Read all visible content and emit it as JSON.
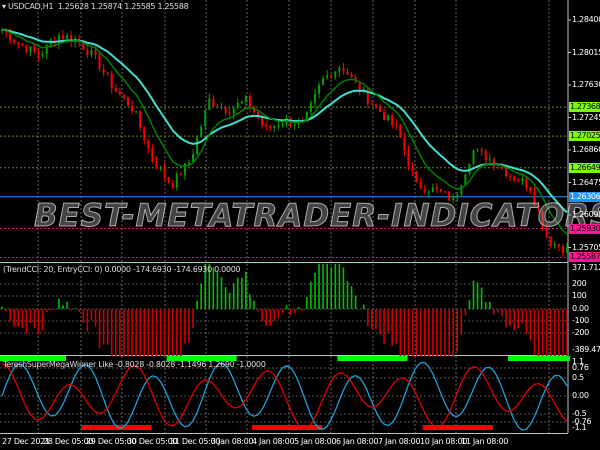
{
  "main_chart": {
    "title": "USDCAD,H1",
    "ohlc": [
      "1.25628",
      "1.25874",
      "1.25585",
      "1.25588"
    ],
    "price_ticks": [
      "1.28400",
      "1.28015",
      "1.27630",
      "1.27245",
      "1.26860",
      "1.26475",
      "1.26090",
      "1.25705"
    ],
    "price_tags": [
      {
        "value": "1.27368",
        "color": "#7cfc00"
      },
      {
        "value": "1.27025",
        "color": "#7cfc00"
      },
      {
        "value": "1.26649",
        "color": "#7cfc00"
      },
      {
        "value": "1.26306",
        "color": "#1e90ff"
      },
      {
        "value": "1.25930",
        "color": "#ff1493"
      },
      {
        "value": "1.25587",
        "color": "#ff1493"
      }
    ],
    "watermark": "BEST-METATRADER-INDICATORS.COM"
  },
  "cci_panel": {
    "title": "(TrendCCI: 20, EntryCCI: 0)",
    "values": "0.0000 -174.6930 -174.6930 0.0000",
    "ticks": [
      "371.7126",
      "200",
      "100",
      "0.00",
      "-100",
      "-200",
      "-389.4724"
    ]
  },
  "megawinner_panel": {
    "title": "TereshSuperMegaWinner Like",
    "values": "-0.8028 -0.8028 -1.1496 1.2690 -1.0000",
    "ticks": [
      "1.1",
      "0.76",
      "0.5",
      "0.00",
      "-0.5",
      "-0.76",
      "-1.1"
    ]
  },
  "time_axis": [
    "27 Dec 2021",
    "28 Dec 05:00",
    "29 Dec 05:00",
    "30 Dec 05:00",
    "31 Dec 05:00",
    "3 Jan 08:00",
    "4 Jan 08:00",
    "5 Jan 08:00",
    "6 Jan 08:00",
    "7 Jan 08:00",
    "10 Jan 08:00",
    "11 Jan 08:00"
  ],
  "chart_data": {
    "type": "candlestick",
    "symbol": "USDCAD",
    "timeframe": "H1",
    "ylim": [
      1.2553,
      1.2856
    ],
    "approx_close_path": [
      1.28282,
      1.28104,
      1.27985,
      1.28222,
      1.28163,
      1.27926,
      1.27571,
      1.27334,
      1.26741,
      1.26445,
      1.26741,
      1.27452,
      1.27334,
      1.27452,
      1.27097,
      1.27215,
      1.27156,
      1.27689,
      1.27867,
      1.27571,
      1.27334,
      1.27097,
      1.26445,
      1.26386,
      1.26267,
      1.2686,
      1.26741,
      1.26563,
      1.26445,
      1.25793,
      1.25674
    ],
    "colors": {
      "up": "#00a000",
      "down": "#ff0000",
      "ma_slow": "#40e0d0",
      "ma_fast": "#008000",
      "cci_pos": "#00c000",
      "cci_neg": "#d00000"
    }
  }
}
